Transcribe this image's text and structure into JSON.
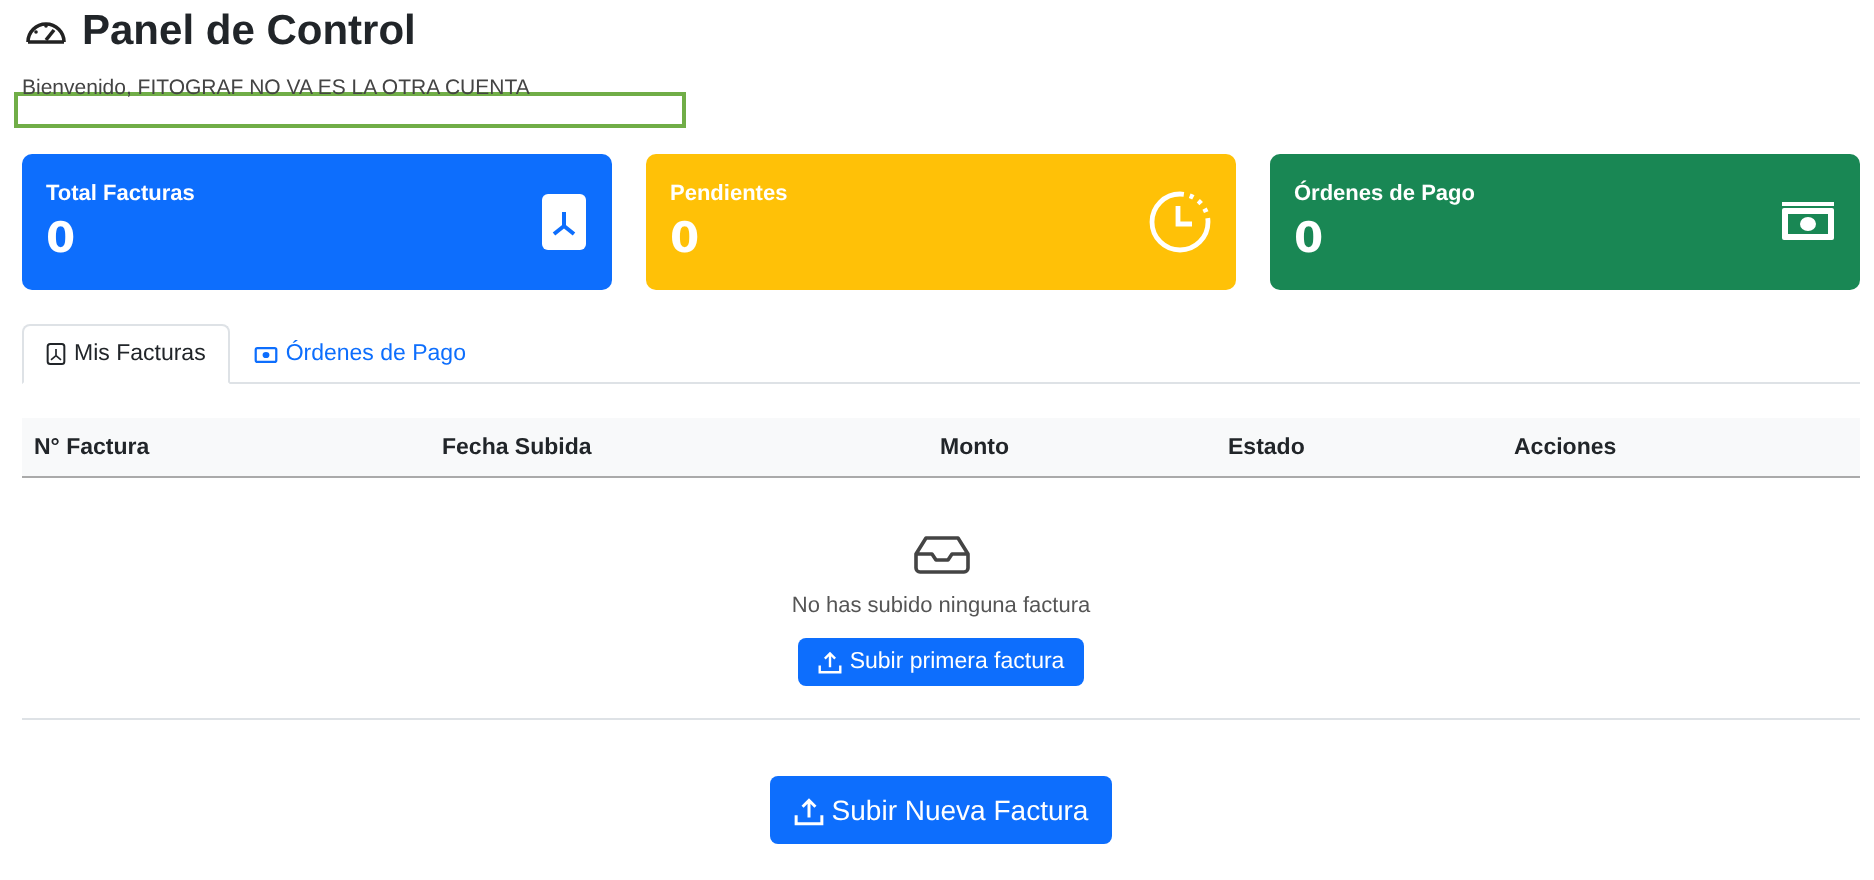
{
  "header": {
    "title": "Panel de Control",
    "welcome": "Bienvenido, FITOGRAF NO VA ES LA OTRA CUENTA"
  },
  "highlight": {
    "kind": "frame",
    "color": "#70ad47"
  },
  "cards": [
    {
      "label": "Total Facturas",
      "value": "0",
      "color": "#0d6efd",
      "kind": "pdf"
    },
    {
      "label": "Pendientes",
      "value": "0",
      "color": "#ffc107",
      "kind": "clock"
    },
    {
      "label": "Órdenes de Pago",
      "value": "0",
      "color": "#198754",
      "kind": "cash"
    }
  ],
  "tabs": [
    {
      "label": "Mis Facturas",
      "selected": true,
      "kind": "pdf"
    },
    {
      "label": "Órdenes de Pago",
      "selected": false,
      "kind": "cash"
    }
  ],
  "table": {
    "columns": [
      "N° Factura",
      "Fecha Subida",
      "Monto",
      "Estado",
      "Acciones"
    ],
    "empty": {
      "message": "No has subido ninguna factura",
      "button": "Subir primera factura"
    }
  },
  "upload_button": "Subir Nueva Factura"
}
